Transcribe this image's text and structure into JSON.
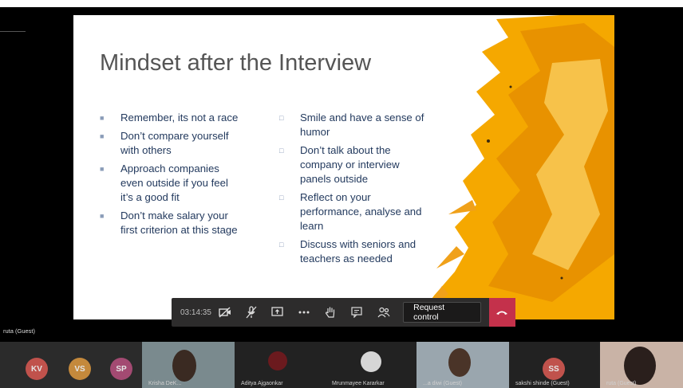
{
  "slide": {
    "title": "Mindset after the Interview",
    "left_bullets": [
      "Remember, its not a race",
      "Don’t compare yourself with others",
      "Approach companies even outside if you feel it’s a good fit",
      "Don’t make salary your first criterion at this stage"
    ],
    "right_bullets": [
      "Smile and have a sense of humor",
      "Don’t talk about the company or interview panels outside",
      "Reflect on your performance, analyse and learn",
      "Discuss with seniors and teachers as needed"
    ]
  },
  "toolbar": {
    "timer": "03:14:35",
    "request_control_label": "Request control",
    "icons": [
      "camera-off-icon",
      "mic-off-icon",
      "share-screen-icon",
      "more-icon",
      "raise-hand-icon",
      "chat-icon",
      "participants-icon",
      "hang-up-icon"
    ]
  },
  "presenter": {
    "label": "ruta (Guest)"
  },
  "participants": {
    "initials": [
      {
        "initials": "KV",
        "color": "#c0524c"
      },
      {
        "initials": "VS",
        "color": "#c4893c"
      },
      {
        "initials": "SP",
        "color": "#a34a72"
      },
      {
        "initials": "SS",
        "color": "#c0524c"
      }
    ],
    "tiles": [
      {
        "name": "Krisha DeK..."
      },
      {
        "name": "Aditya Ajgaonkar"
      },
      {
        "name": "Mrunmayee Kararkar"
      },
      {
        "name": "...a diwi (Guest)"
      },
      {
        "name": "sakshi shinde (Guest)"
      },
      {
        "name": "ruta (Guest)"
      }
    ]
  },
  "colors": {
    "accent_hangup": "#c4314b",
    "slide_text": "#233a5e",
    "title_text": "#555555",
    "splash": "#f5a800"
  }
}
